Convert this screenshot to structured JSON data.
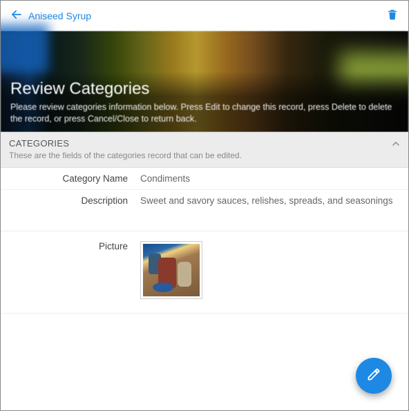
{
  "header": {
    "back_label": "Aniseed Syrup"
  },
  "hero": {
    "title": "Review Categories",
    "subtitle": "Please review categories information below. Press Edit to change this record, press Delete to delete the record, or press Cancel/Close to return back."
  },
  "section": {
    "title": "CATEGORIES",
    "subtitle": "These are the fields of the categories record that can be edited."
  },
  "fields": {
    "category_name_label": "Category Name",
    "category_name_value": "Condiments",
    "description_label": "Description",
    "description_value": "Sweet and savory sauces, relishes, spreads, and seasonings",
    "picture_label": "Picture"
  },
  "colors": {
    "accent": "#1e88e5"
  }
}
